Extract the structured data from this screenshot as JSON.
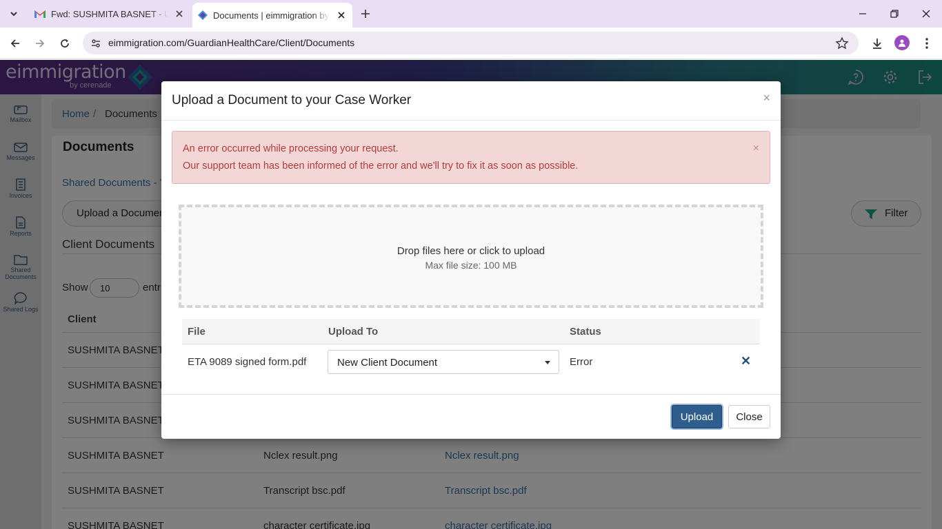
{
  "browser": {
    "tabs": [
      {
        "title": "Fwd: SUSHMITA BASNET - User",
        "icon": "gmail-icon"
      },
      {
        "title": "Documents | eimmigration by C",
        "icon": "eimmigration-icon"
      }
    ],
    "url": "eimmigration.com/GuardianHealthCare/Client/Documents"
  },
  "app": {
    "logo": "eimmigration",
    "logo_sub": "by cerenade",
    "sidebar": [
      {
        "label": "Mailbox",
        "icon": "mailbox-icon"
      },
      {
        "label": "Messages",
        "icon": "envelope-icon"
      },
      {
        "label": "Invoices",
        "icon": "invoice-icon"
      },
      {
        "label": "Reports",
        "icon": "report-icon"
      },
      {
        "label": "Shared Documents",
        "icon": "folder-icon"
      },
      {
        "label": "Shared Logs",
        "icon": "chat-icon"
      }
    ],
    "breadcrumb": {
      "home": "Home",
      "sep": "/",
      "current": "Documents"
    },
    "page_title": "Documents",
    "shared_link": "Shared Documents - Y",
    "upload_button": "Upload a Documen",
    "filter_button": "Filter",
    "client_docs_title": "Client Documents",
    "show_label": "Show",
    "show_value": "10",
    "show_after": "entr",
    "table_header_client": "Client",
    "rows": [
      {
        "client": "SUSHMITA BASNET",
        "name": "",
        "file": ""
      },
      {
        "client": "SUSHMITA BASNET",
        "name": "",
        "file": ""
      },
      {
        "client": "SUSHMITA BASNET",
        "name": "",
        "file": ""
      },
      {
        "client": "SUSHMITA BASNET",
        "name": "Nclex result.png",
        "file": "Nclex result.png"
      },
      {
        "client": "SUSHMITA BASNET",
        "name": "Transcript bsc.pdf",
        "file": "Transcript bsc.pdf"
      },
      {
        "client": "SUSHMITA BASNET",
        "name": "character certificate.jpg",
        "file": "character certificate.jpg"
      }
    ]
  },
  "modal": {
    "title": "Upload a Document to your Case Worker",
    "close_x": "×",
    "alert_line1": "An error occurred while processing your request.",
    "alert_line2": "Our support team has been informed of the error and we'll try to fix it as soon as possible.",
    "alert_x": "×",
    "dropzone_msg": "Drop files here or click to upload",
    "dropzone_sub": "Max file size: 100 MB",
    "table_headers": {
      "file": "File",
      "upload_to": "Upload To",
      "status": "Status"
    },
    "file_row": {
      "file": "ETA 9089 signed form.pdf",
      "upload_to": "New Client Document",
      "status": "Error",
      "remove": "✕"
    },
    "upload_button": "Upload",
    "close_button": "Close"
  }
}
